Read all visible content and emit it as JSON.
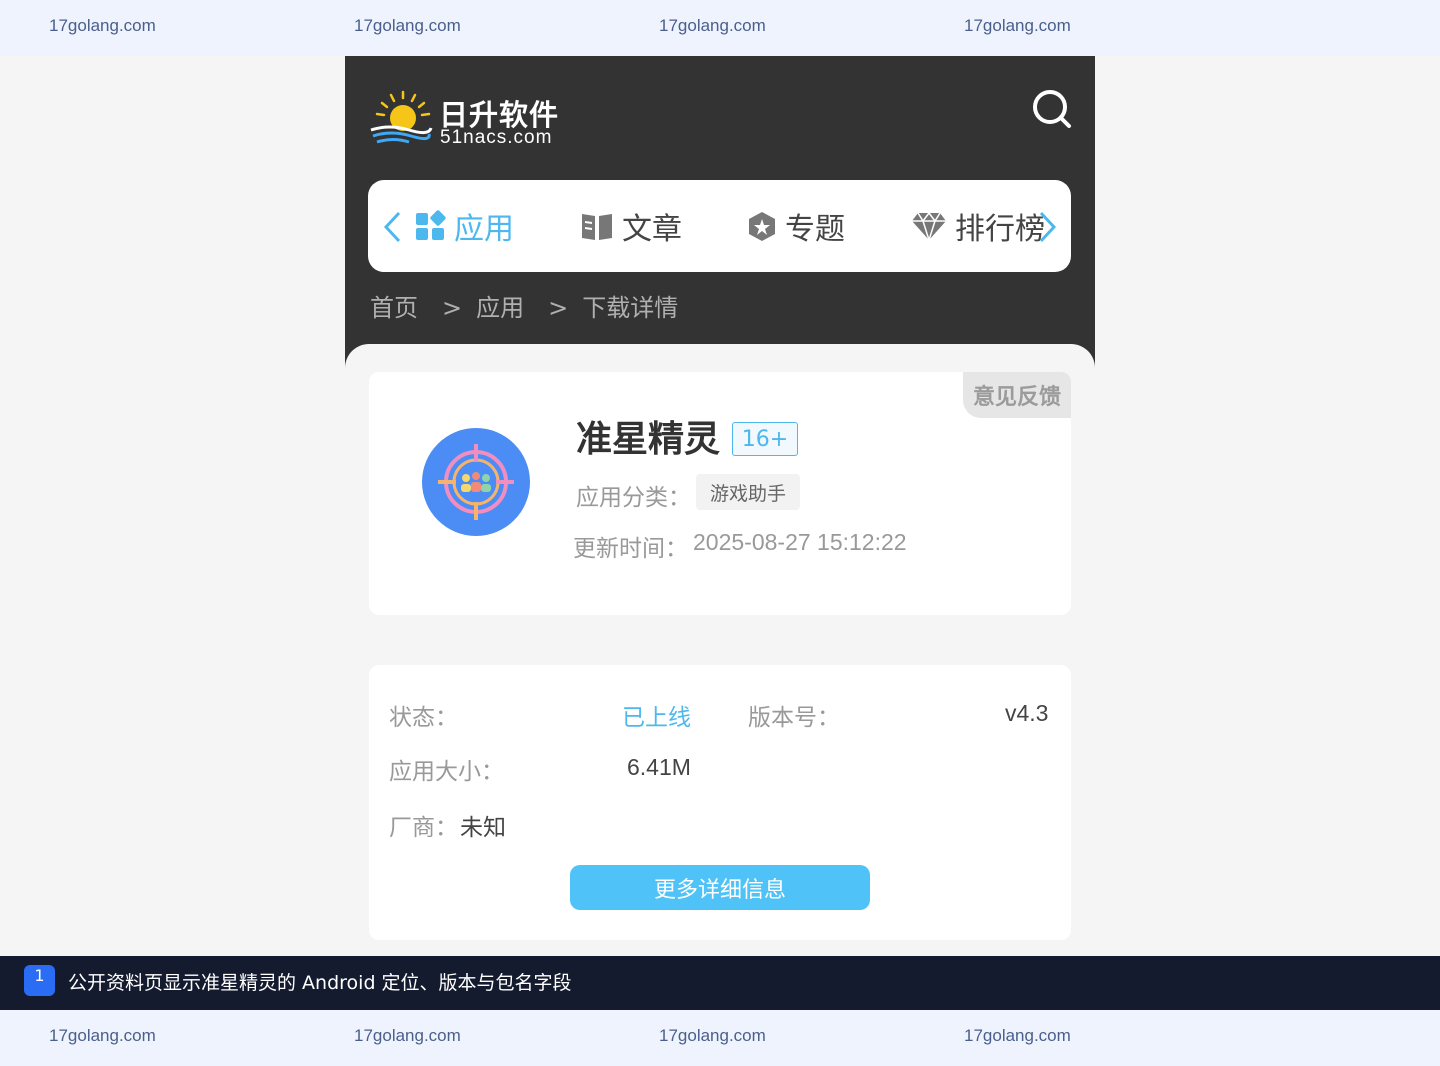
{
  "watermark": {
    "top": [
      "17golang.com",
      "17golang.com",
      "17golang.com",
      "17golang.com"
    ],
    "bottom": [
      "17golang.com",
      "17golang.com",
      "17golang.com",
      "17golang.com"
    ]
  },
  "header": {
    "logo_cn": "日升软件",
    "logo_en": "51nacs.com",
    "search_icon": "search-icon"
  },
  "nav": {
    "prev_icon": "chevron-left-icon",
    "next_icon": "chevron-right-icon",
    "items": [
      {
        "label": "应用",
        "icon": "apps-grid-icon",
        "active": true
      },
      {
        "label": "文章",
        "icon": "book-icon",
        "active": false
      },
      {
        "label": "专题",
        "icon": "star-hexagon-icon",
        "active": false
      },
      {
        "label": "排行榜",
        "icon": "diamond-icon",
        "active": false
      }
    ]
  },
  "breadcrumb": {
    "home": "首页",
    "sep": ">",
    "category": "应用",
    "current": "下载详情"
  },
  "app": {
    "feedback": "意见反馈",
    "name": "准星精灵",
    "age_rating": "16+",
    "category_label": "应用分类：",
    "category_value": "游戏助手",
    "update_label": "更新时间：",
    "update_value": "2025-08-27 15:12:22"
  },
  "info": {
    "status_label": "状态：",
    "status_value": "已上线",
    "version_label": "版本号：",
    "version_value": "v4.3",
    "size_label": "应用大小：",
    "size_value": "6.41M",
    "vendor_label": "厂商：",
    "vendor_value": "未知",
    "more_button": "更多详细信息"
  },
  "caption": {
    "number": "1",
    "text": "公开资料页显示准星精灵的 Android 定位、版本与包名字段"
  },
  "colors": {
    "accent": "#4db8ee",
    "header_bg": "#333333",
    "button": "#4fc3f7",
    "caption_bg": "#141b2f"
  }
}
